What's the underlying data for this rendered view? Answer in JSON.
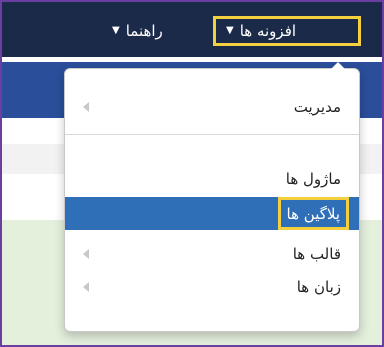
{
  "navbar": {
    "extensions_label": "افزونه ها",
    "help_label": "راهنما"
  },
  "dropdown": {
    "items": [
      {
        "label": "مدیریت",
        "has_submenu": true
      },
      {
        "label": "ماژول ها",
        "has_submenu": false
      },
      {
        "label": "پلاگین ها",
        "has_submenu": false,
        "active": true
      },
      {
        "label": "قالب ها",
        "has_submenu": true
      },
      {
        "label": "زبان ها",
        "has_submenu": true
      }
    ]
  },
  "colors": {
    "navbar_bg": "#1c2a4a",
    "subbar_bg": "#2a4e9a",
    "active_item_bg": "#2f6fb7",
    "highlight_border": "#f4d03f",
    "frame_border": "#6a3fa0"
  },
  "icons": {
    "caret": "caret-down-icon",
    "submenu": "submenu-arrow-icon"
  }
}
